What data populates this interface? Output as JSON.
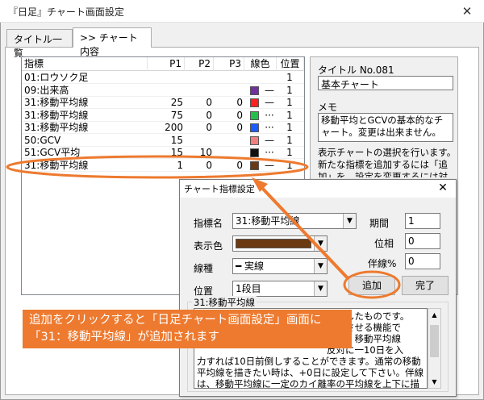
{
  "window": {
    "title": "『日足』チャート画面設定",
    "close_glyph": "✕"
  },
  "tabs": [
    {
      "label": "タイトル一覧",
      "active": false
    },
    {
      "label": ">> チャート内容",
      "active": true
    }
  ],
  "list": {
    "headers": {
      "name": "指標",
      "p1": "P1",
      "p2": "P2",
      "p3": "P3",
      "color": "線色",
      "pos": "位置"
    },
    "rows": [
      {
        "name": "01:ロウソク足",
        "p1": "",
        "p2": "",
        "p3": "",
        "color": "",
        "line": "",
        "pos": "1"
      },
      {
        "name": "09:出来高",
        "p1": "",
        "p2": "",
        "p3": "",
        "color": "#7030a0",
        "line": "—",
        "pos": "1"
      },
      {
        "name": "31:移動平均線",
        "p1": "25",
        "p2": "0",
        "p3": "0",
        "color": "#ff2020",
        "line": "—",
        "pos": "1"
      },
      {
        "name": "31:移動平均線",
        "p1": "75",
        "p2": "0",
        "p3": "0",
        "color": "#22c04a",
        "line": "···",
        "pos": "1"
      },
      {
        "name": "31:移動平均線",
        "p1": "200",
        "p2": "0",
        "p3": "0",
        "color": "#1a5cff",
        "line": "···",
        "pos": "1"
      },
      {
        "name": "50:GCV",
        "p1": "15",
        "p2": "",
        "p3": "",
        "color": "#f08080",
        "line": "—",
        "pos": "1"
      },
      {
        "name": "51:GCV平均",
        "p1": "15",
        "p2": "10",
        "p3": "",
        "color": "#111111",
        "line": "···",
        "pos": "1"
      },
      {
        "name": "31:移動平均線",
        "p1": "1",
        "p2": "0",
        "p3": "0",
        "color": "#6b3a12",
        "line": "—",
        "pos": "1"
      }
    ]
  },
  "info": {
    "title_label": "タイトル No.081",
    "title_value": "基本チャート",
    "memo_label": "メモ",
    "memo_value": "移動平均とGCVの基本的なチャート。変更は出来ません。",
    "description": "表示チャートの選択を行います。新たな指標を追加するには「追加」を、設定を変更するには対象"
  },
  "dialog": {
    "title": "チャート指標設定",
    "close_glyph": "✕",
    "indicator_label": "指標名",
    "indicator_value": "31:移動平均線",
    "color_label": "表示色",
    "color_value": "#6b3a12",
    "linetype_label": "線種",
    "linetype_value": "━ 実線",
    "position_label": "位置",
    "position_value": "1段目",
    "period_label": "期間",
    "period_value": "1",
    "phase_label": "位相",
    "phase_value": "0",
    "deviation_label": "伴線%",
    "deviation_value": "0",
    "add_label": "追加",
    "done_label": "完了",
    "group_label": "31:移動平均線",
    "help_text": "　　　　　　　　　　　　　　線にしたものです。\n　　　　　　　　　　　　　　運行させる機能で\n　　　　　　　　　　　　　　れば、移動平均線\n　　　　　　　　　　　　　　反対に一10日を入\n力すれば10日前倒しすることができます。通常の移動\n平均線を描きたい時は、+0日に設定して下さい。伴線\nは、移動平均線に一定のカイ離率の平均線を上下に描"
  },
  "callout": {
    "text": "追加をクリックすると「日足チャート画面設定」画面に「31：移動平均線」が追加されます",
    "color": "#ed7a2f"
  },
  "dropdown_glyph": "▼"
}
